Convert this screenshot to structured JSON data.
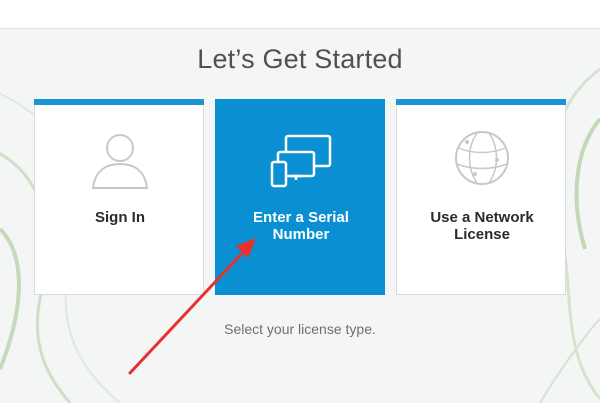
{
  "page": {
    "title": "Let’s Get Started",
    "subtitle": "Select your license type."
  },
  "cards": [
    {
      "label": "Sign In",
      "icon": "user-silhouette-icon",
      "selected": false
    },
    {
      "label_line1": "Enter a Serial",
      "label_line2": "Number",
      "icon": "devices-icon",
      "selected": true
    },
    {
      "label_line1": "Use a Network",
      "label_line2": "License",
      "icon": "globe-network-icon",
      "selected": false
    }
  ],
  "colors": {
    "accent": "#1c94d2",
    "selected_card": "#0a8fd3",
    "annotation_arrow": "#e8312f"
  }
}
